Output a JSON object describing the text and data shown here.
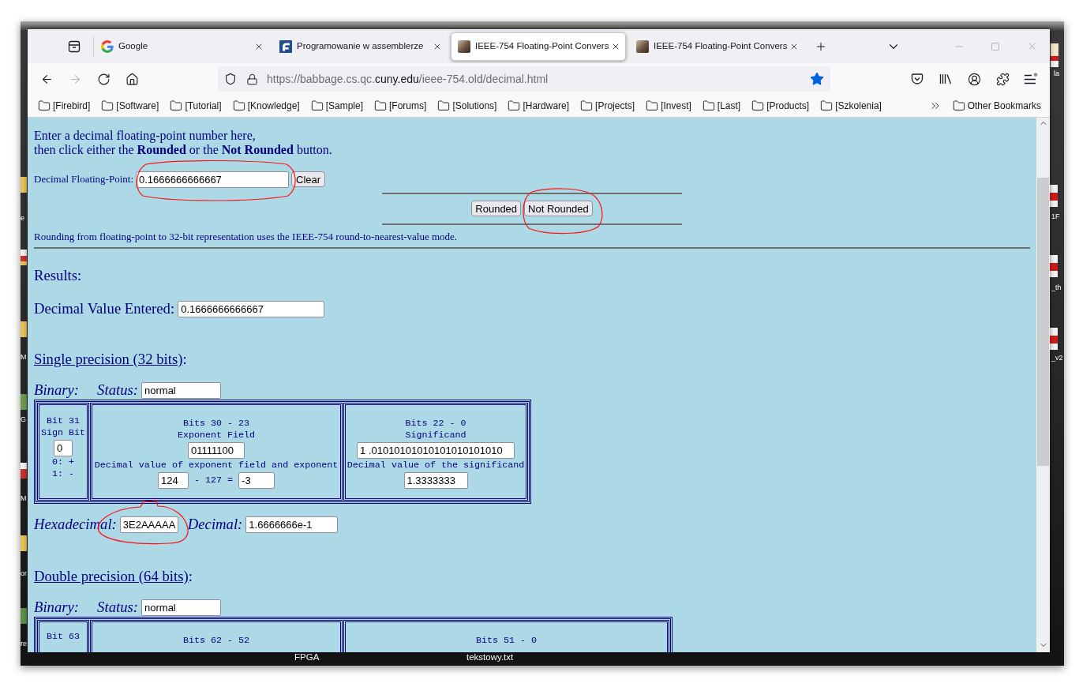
{
  "desktop": {
    "bottom_labels": [
      "FPGA",
      "tekstowy.txt"
    ],
    "right_labels": [
      "la",
      "1F",
      "_th",
      "_v2"
    ],
    "left_labels": [
      "e",
      "M",
      "G",
      "M",
      "or",
      "re"
    ]
  },
  "browser": {
    "tabs": [
      {
        "title": "Google",
        "kind": "google",
        "selected": false
      },
      {
        "title": "Programowanie w assemblerze",
        "kind": "letter",
        "selected": false
      },
      {
        "title": "IEEE-754 Floating-Point Convers",
        "kind": "photo",
        "selected": true
      },
      {
        "title": "IEEE-754 Floating-Point Convers",
        "kind": "photo",
        "selected": false
      }
    ],
    "nav": [
      {
        "kind": "back",
        "disabled": false
      },
      {
        "kind": "forward",
        "disabled": true
      },
      {
        "kind": "reload",
        "disabled": false
      },
      {
        "kind": "home",
        "disabled": false
      }
    ],
    "address": {
      "scheme_host": "https://babbage.cs.qc.",
      "domain": "cuny.edu",
      "path": "/ieee-754.old/decimal.html",
      "bookmarked": true
    },
    "bookmarks": [
      "[Firebird]",
      "[Software]",
      "[Tutorial]",
      "[Knowledge]",
      "[Sample]",
      "[Forums]",
      "[Solutions]",
      "[Hardware]",
      "[Projects]",
      "[Invest]",
      "[Last]",
      "[Products]",
      "[Szkolenia]"
    ],
    "other_bookmarks": "Other Bookmarks"
  },
  "page": {
    "intro": [
      "Enter a decimal floating-point number here,",
      "then click either the **Rounded** or the **Not Rounded** button."
    ],
    "input": {
      "label": "Decimal Floating-Point:",
      "value": "0.1666666666667",
      "clear": "Clear"
    },
    "buttons": [
      "Rounded",
      "Not Rounded"
    ],
    "note": "Rounding from floating-point to 32-bit representation uses the IEEE-754 round-to-nearest-value mode.",
    "results_heading": "Results:",
    "entered": {
      "label": "Decimal Value Entered:",
      "value": "0.1666666666667"
    },
    "single": {
      "link": "Single precision (32 bits)",
      "suffix": ":",
      "binary_label": "Binary:",
      "status_label": "Status:",
      "status": "normal",
      "sign": {
        "heading": [
          "Bit 31",
          "Sign Bit"
        ],
        "value": "0",
        "legend": [
          "0: +",
          "1: -"
        ]
      },
      "exponent": {
        "heading": [
          "Bits 30 - 23",
          "Exponent Field"
        ],
        "value": "01111100",
        "caption": "Decimal value of exponent field and exponent",
        "biased": "124",
        "bias_text": "- 127 =",
        "unbiased": "-3"
      },
      "significand": {
        "heading": [
          "Bits 22 - 0",
          "Significand"
        ],
        "value": "1 .01010101010101010101010",
        "caption": "Decimal value of the significand",
        "decimal": "1.3333333"
      },
      "hex_label": "Hexadecimal:",
      "hex": "3E2AAAAA",
      "decimal_label": "Decimal:",
      "decimal": "1.6666666e-1"
    },
    "double": {
      "link": "Double precision (64 bits)",
      "suffix": ":",
      "binary_label": "Binary:",
      "status_label": "Status:",
      "status": "normal",
      "headings": [
        "Bit 63",
        "Bits 62 - 52",
        "Bits 51 - 0"
      ]
    }
  }
}
